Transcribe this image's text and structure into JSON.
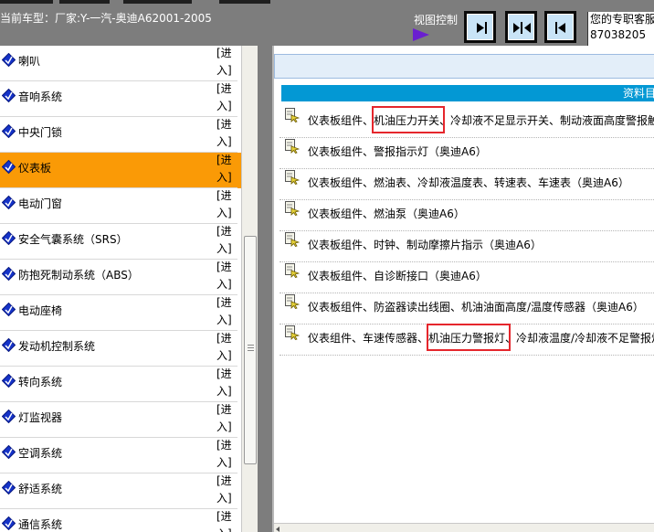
{
  "header": {
    "car_model": "当前车型：厂家:Y-一汽-奥迪A62001-2005",
    "view_control": "视图控制",
    "hotline_line1": "您的专职客服",
    "hotline_line2": "87038205",
    "buttons": [
      "show-right-pane-icon",
      "split-pane-icon",
      "show-left-pane-icon"
    ]
  },
  "sidebar": {
    "enter_label": "[进入]",
    "items": [
      {
        "label": "喇叭",
        "active": false
      },
      {
        "label": "音响系统",
        "active": false
      },
      {
        "label": "中央门锁",
        "active": false
      },
      {
        "label": "仪表板",
        "active": true
      },
      {
        "label": "电动门窗",
        "active": false
      },
      {
        "label": "安全气囊系统（SRS）",
        "active": false
      },
      {
        "label": "防抱死制动系统（ABS）",
        "active": false
      },
      {
        "label": "电动座椅",
        "active": false
      },
      {
        "label": "发动机控制系统",
        "active": false
      },
      {
        "label": "转向系统",
        "active": false
      },
      {
        "label": "灯监视器",
        "active": false
      },
      {
        "label": "空调系统",
        "active": false
      },
      {
        "label": "舒适系统",
        "active": false
      },
      {
        "label": "通信系统",
        "active": false
      }
    ]
  },
  "content": {
    "data_title": "资料目",
    "documents": [
      {
        "text": "仪表板组件、机油压力开关、冷却液不足显示开关、制动液面高度警报触"
      },
      {
        "text": "仪表板组件、警报指示灯（奥迪A6）"
      },
      {
        "text": "仪表板组件、燃油表、冷却液温度表、转速表、车速表（奥迪A6）"
      },
      {
        "text": "仪表板组件、燃油泵（奥迪A6）"
      },
      {
        "text": "仪表板组件、时钟、制动摩擦片指示（奥迪A6）"
      },
      {
        "text": "仪表板组件、自诊断接口（奥迪A6）"
      },
      {
        "text": "仪表板组件、防盗器读出线圈、机油油面高度/温度传感器（奥迪A6）"
      },
      {
        "text": "仪表组件、车速传感器、机油压力警报灯、冷却液温度/冷却液不足警报灯"
      }
    ],
    "highlights": [
      "机油压力开关",
      "机油压力警报灯"
    ]
  },
  "colors": {
    "header_bg": "#7d7d7d",
    "active_item_bg": "#fa9a06",
    "data_bar_bg": "#0398d4",
    "highlight_border": "#e5262c",
    "nav_icon_blue": "#1533c8"
  }
}
